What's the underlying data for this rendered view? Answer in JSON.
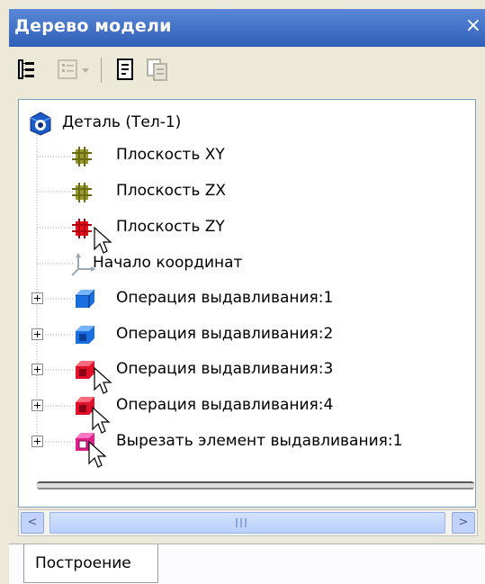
{
  "window": {
    "title": "Дерево модели",
    "close_glyph": "×"
  },
  "toolbar": {
    "buttons": [
      {
        "icon": "tree-structure-icon"
      },
      {
        "icon": "filter-list-icon"
      },
      {
        "icon": "page-icon"
      },
      {
        "icon": "copy-page-icon"
      }
    ]
  },
  "tree": {
    "root": {
      "label": "Деталь (Тел-1)",
      "icon": "part-icon"
    },
    "items": [
      {
        "label": "Плоскость XY",
        "icon": "plane-icon"
      },
      {
        "label": "Плоскость ZX",
        "icon": "plane-icon"
      },
      {
        "label": "Плоскость ZY",
        "icon": "plane-selected-icon"
      },
      {
        "label": "Начало координат",
        "icon": "coordinate-origin-icon"
      },
      {
        "label": "Операция выдавливания:1",
        "icon": "extrude-cube-icon",
        "expandable": true
      },
      {
        "label": "Операция выдавливания:2",
        "icon": "extrude-frame-icon",
        "expandable": true
      },
      {
        "label": "Операция выдавливания:3",
        "icon": "extrude-red-icon",
        "expandable": true
      },
      {
        "label": "Операция выдавливания:4",
        "icon": "extrude-red-icon",
        "expandable": true
      },
      {
        "label": "Вырезать элемент выдавливания:1",
        "icon": "cut-extrude-icon",
        "expandable": true
      }
    ]
  },
  "scrollbar": {
    "left_arrow": "<",
    "right_arrow": ">",
    "grip": "|||"
  },
  "tabs": [
    {
      "label": "Построение"
    }
  ],
  "colors": {
    "title_bar": "#3a6cc4",
    "plane_olive": "#9a9a2e",
    "plane_red": "#e8101c",
    "extrude_blue": "#1a6fe0",
    "extrude_red": "#e0102a",
    "cut_magenta": "#e0208a"
  }
}
